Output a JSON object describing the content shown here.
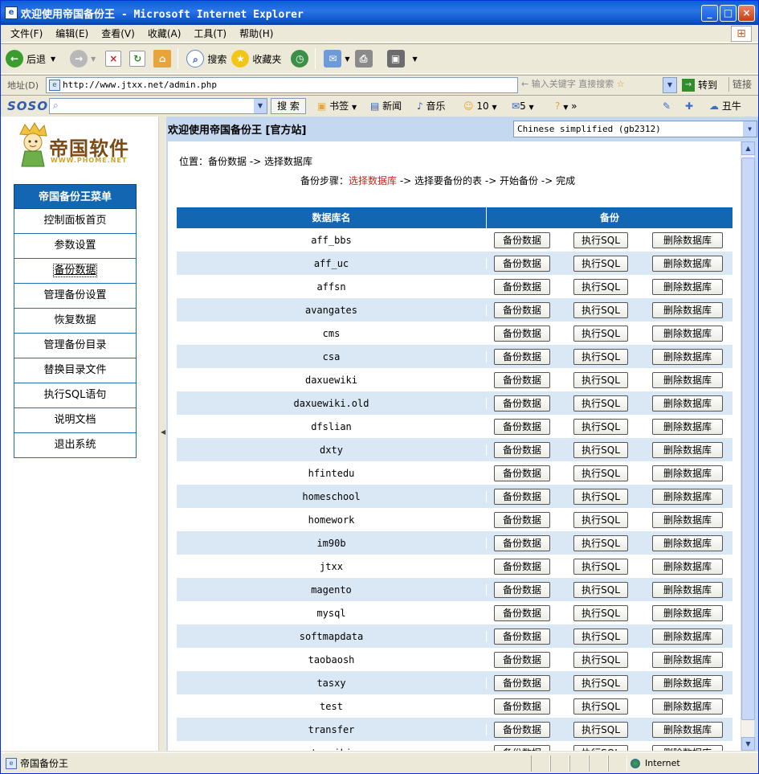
{
  "window": {
    "title": "欢迎使用帝国备份王 - Microsoft Internet Explorer",
    "minimize": "_",
    "maximize": "□",
    "close": "×"
  },
  "menubar": [
    "文件(F)",
    "编辑(E)",
    "查看(V)",
    "收藏(A)",
    "工具(T)",
    "帮助(H)"
  ],
  "toolbar": {
    "back": "后退",
    "search": "搜索",
    "favorites": "收藏夹"
  },
  "address": {
    "label": "地址(D)",
    "url": "http://www.jtxx.net/admin.php",
    "search_placeholder": "输入关键字 直接搜索",
    "go": "转到",
    "links": "链接"
  },
  "soso": {
    "logo": "SOSO",
    "search_button": "搜 索",
    "bookmarks": "书签",
    "news": "新闻",
    "music": "音乐",
    "count1": "10",
    "count2": "5",
    "date": "丑牛"
  },
  "sidebar": {
    "logo_text": "帝国软件",
    "logo_url": "WWW.PHOME.NET",
    "menu_title": "帝国备份王菜单",
    "items": [
      "控制面板首页",
      "参数设置",
      "备份数据",
      "管理备份设置",
      "恢复数据",
      "管理备份目录",
      "替换目录文件",
      "执行SQL语句",
      "说明文档",
      "退出系统"
    ],
    "active_index": 2
  },
  "header": {
    "title": "欢迎使用帝国备份王 [官方站]",
    "language": "Chinese simplified (gb2312)"
  },
  "main": {
    "position": "位置：备份数据 -> 选择数据库",
    "steps_prefix": "备份步骤：",
    "steps_current": "选择数据库",
    "steps_rest": " -> 选择要备份的表 -> 开始备份 -> 完成",
    "col_dbname": "数据库名",
    "col_backup": "备份",
    "btn_backup": "备份数据",
    "btn_sql": "执行SQL",
    "btn_delete": "删除数据库",
    "databases": [
      "aff_bbs",
      "aff_uc",
      "affsn",
      "avangates",
      "cms",
      "csa",
      "daxuewiki",
      "daxuewiki.old",
      "dfslian",
      "dxty",
      "hfintedu",
      "homeschool",
      "homework",
      "im90b",
      "jtxx",
      "magento",
      "mysql",
      "softmapdata",
      "taobaosh",
      "tasxy",
      "test",
      "transfer",
      "truwiki"
    ]
  },
  "status": {
    "text": "帝国备份王",
    "zone": "Internet"
  },
  "colors": {
    "header_blue": "#1367b2",
    "alt_row": "#dae8f5",
    "step_current": "#d0201a",
    "frame_bg": "#c4d8f0"
  }
}
